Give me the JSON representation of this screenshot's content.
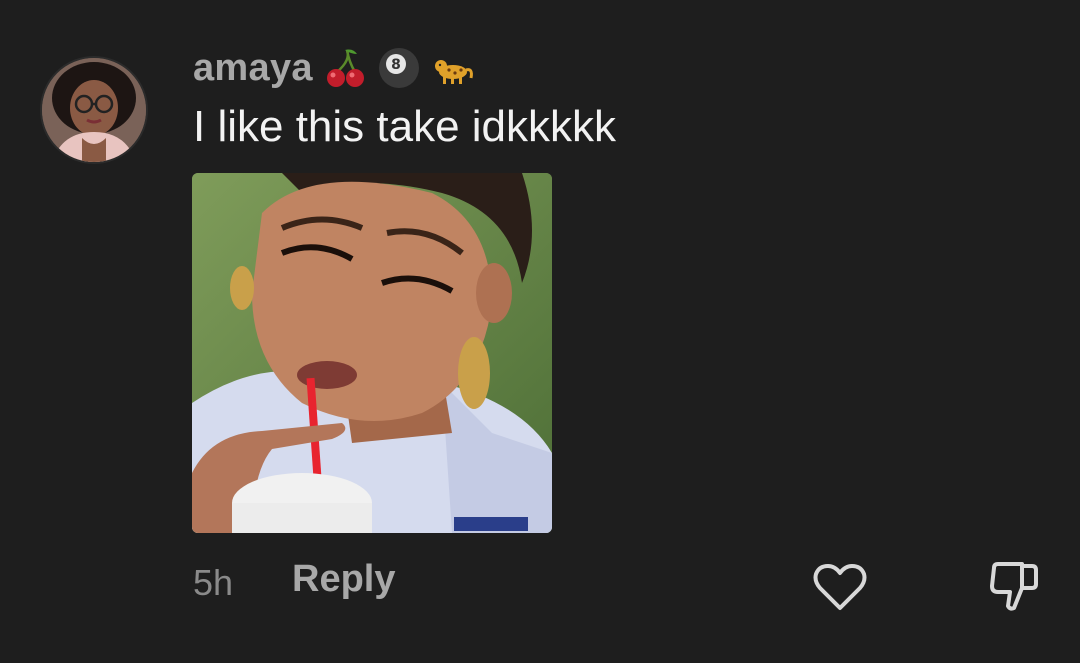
{
  "comment": {
    "username": "amaya",
    "username_emojis": [
      "cherries-emoji",
      "pool-8-ball-emoji",
      "leopard-emoji"
    ],
    "text": "I like this take idkkkkk",
    "timestamp": "5h",
    "reply_label": "Reply"
  },
  "colors": {
    "background": "#1e1e1e",
    "username": "#a8a8a8",
    "text": "#f2f2f2",
    "meta": "#8a8a8a",
    "icon": "#d8d8d8"
  },
  "icons": {
    "like": "heart-outline-icon",
    "dislike": "thumbs-down-outline-icon"
  }
}
